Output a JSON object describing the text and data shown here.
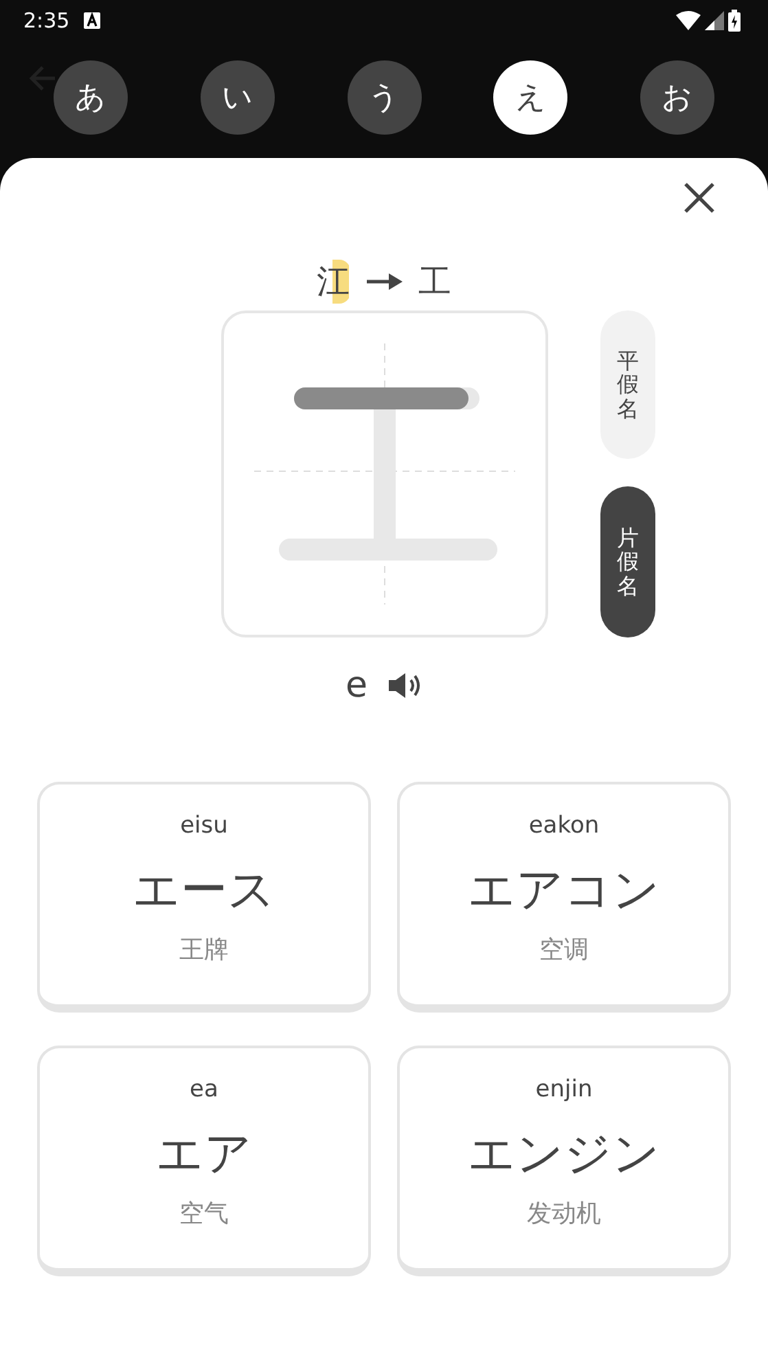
{
  "status_bar": {
    "time": "2:35"
  },
  "vowel_tabs": [
    {
      "label": "あ",
      "selected": false
    },
    {
      "label": "い",
      "selected": false
    },
    {
      "label": "う",
      "selected": false
    },
    {
      "label": "え",
      "selected": true
    },
    {
      "label": "お",
      "selected": false
    }
  ],
  "origin": {
    "source": "江",
    "target": "工"
  },
  "script_toggle": [
    {
      "label": "平假名",
      "selected": false
    },
    {
      "label": "片假名",
      "selected": true
    }
  ],
  "romaji": "e",
  "words": [
    {
      "romaji": "eisu",
      "kana": "エース",
      "meaning": "王牌"
    },
    {
      "romaji": "eakon",
      "kana": "エアコン",
      "meaning": "空调"
    },
    {
      "romaji": "ea",
      "kana": "エア",
      "meaning": "空气"
    },
    {
      "romaji": "enjin",
      "kana": "エンジン",
      "meaning": "发动机"
    }
  ]
}
